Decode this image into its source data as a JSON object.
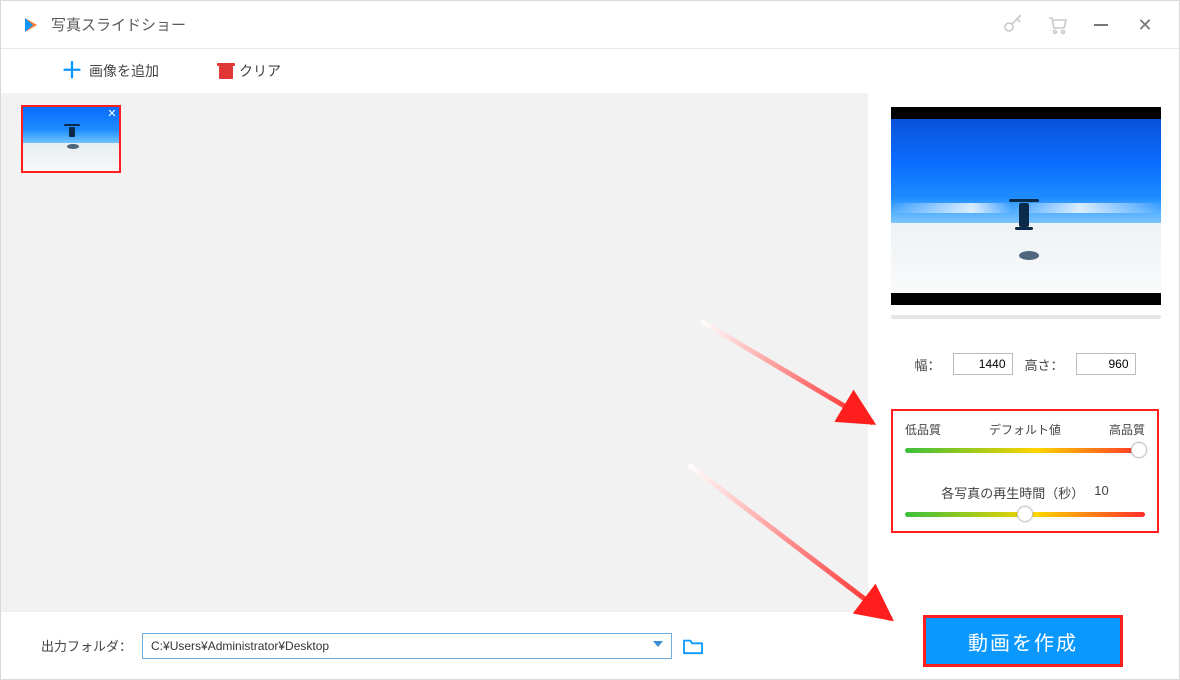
{
  "app": {
    "title": "写真スライドショー"
  },
  "toolbar": {
    "add_label": "画像を追加",
    "clear_label": "クリア"
  },
  "output": {
    "label": "出力フォルダ：",
    "path": "C:¥Users¥Administrator¥Desktop"
  },
  "settings": {
    "width_label": "幅：",
    "width_value": "1440",
    "height_label": "高さ：",
    "height_value": "960",
    "quality_low": "低品質",
    "quality_default": "デフォルト値",
    "quality_high": "高品質",
    "duration_label": "各写真の再生時間（秒）",
    "duration_value": "10"
  },
  "action": {
    "create_label": "動画を作成"
  }
}
